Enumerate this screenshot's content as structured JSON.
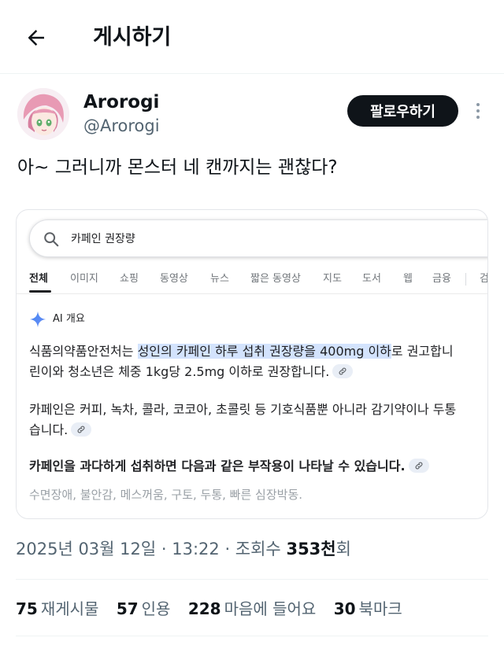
{
  "header": {
    "title": "게시하기"
  },
  "author": {
    "name": "Arorogi",
    "handle": "@Arorogi",
    "follow_label": "팔로우하기"
  },
  "post": {
    "text": "아~ 그러니까 몬스터 네 캔까지는 괜찮다?"
  },
  "screenshot": {
    "search_query": "카페인 권장량",
    "tabs": [
      "전체",
      "이미지",
      "쇼핑",
      "동영상",
      "뉴스",
      "짧은 동영상",
      "지도",
      "도서",
      "웹",
      "금융",
      "검"
    ],
    "active_tab": "전체",
    "ai_overview_title": "AI 개요",
    "p1": {
      "l1_pre": "식품의약품안전처는 ",
      "l1_hl": "성인의 카페인 하루 섭취 권장량을 400mg 이하",
      "l1_post": "로 권고합니",
      "l2": "린이와 청소년은 체중 1kg당 2.5mg 이하로 권장합니다."
    },
    "p2": {
      "l1": "카페인은 커피, 녹차, 콜라, 코코아, 초콜릿 등 기호식품뿐 아니라 감기약이나 두통",
      "l2": "습니다."
    },
    "p3": {
      "l1": "카페인을 과다하게 섭취하면 다음과 같은 부작용이 나타날 수 있습니다."
    },
    "p4": {
      "l1": "수면장애, 불안감, 메스꺼움, 구토, 두통, 빠른 심장박동."
    }
  },
  "meta": {
    "date": "2025년 03월 12일",
    "time": "13:22",
    "views_label": "조회수",
    "views_count": "353천",
    "views_suffix": "회"
  },
  "stats": [
    {
      "count": "75",
      "label": "재게시물"
    },
    {
      "count": "57",
      "label": "인용"
    },
    {
      "count": "228",
      "label": "마음에 들어요"
    },
    {
      "count": "30",
      "label": "북마크"
    }
  ],
  "colors": {
    "text": "#0f1419",
    "secondary": "#536471",
    "highlight": "#d3e3fd",
    "gemini_blue": "#4285f4"
  },
  "icons": {
    "back": "arrow-left-icon",
    "more": "more-vertical-icon",
    "search": "search-icon",
    "ai": "sparkle-icon",
    "link": "link-icon"
  }
}
